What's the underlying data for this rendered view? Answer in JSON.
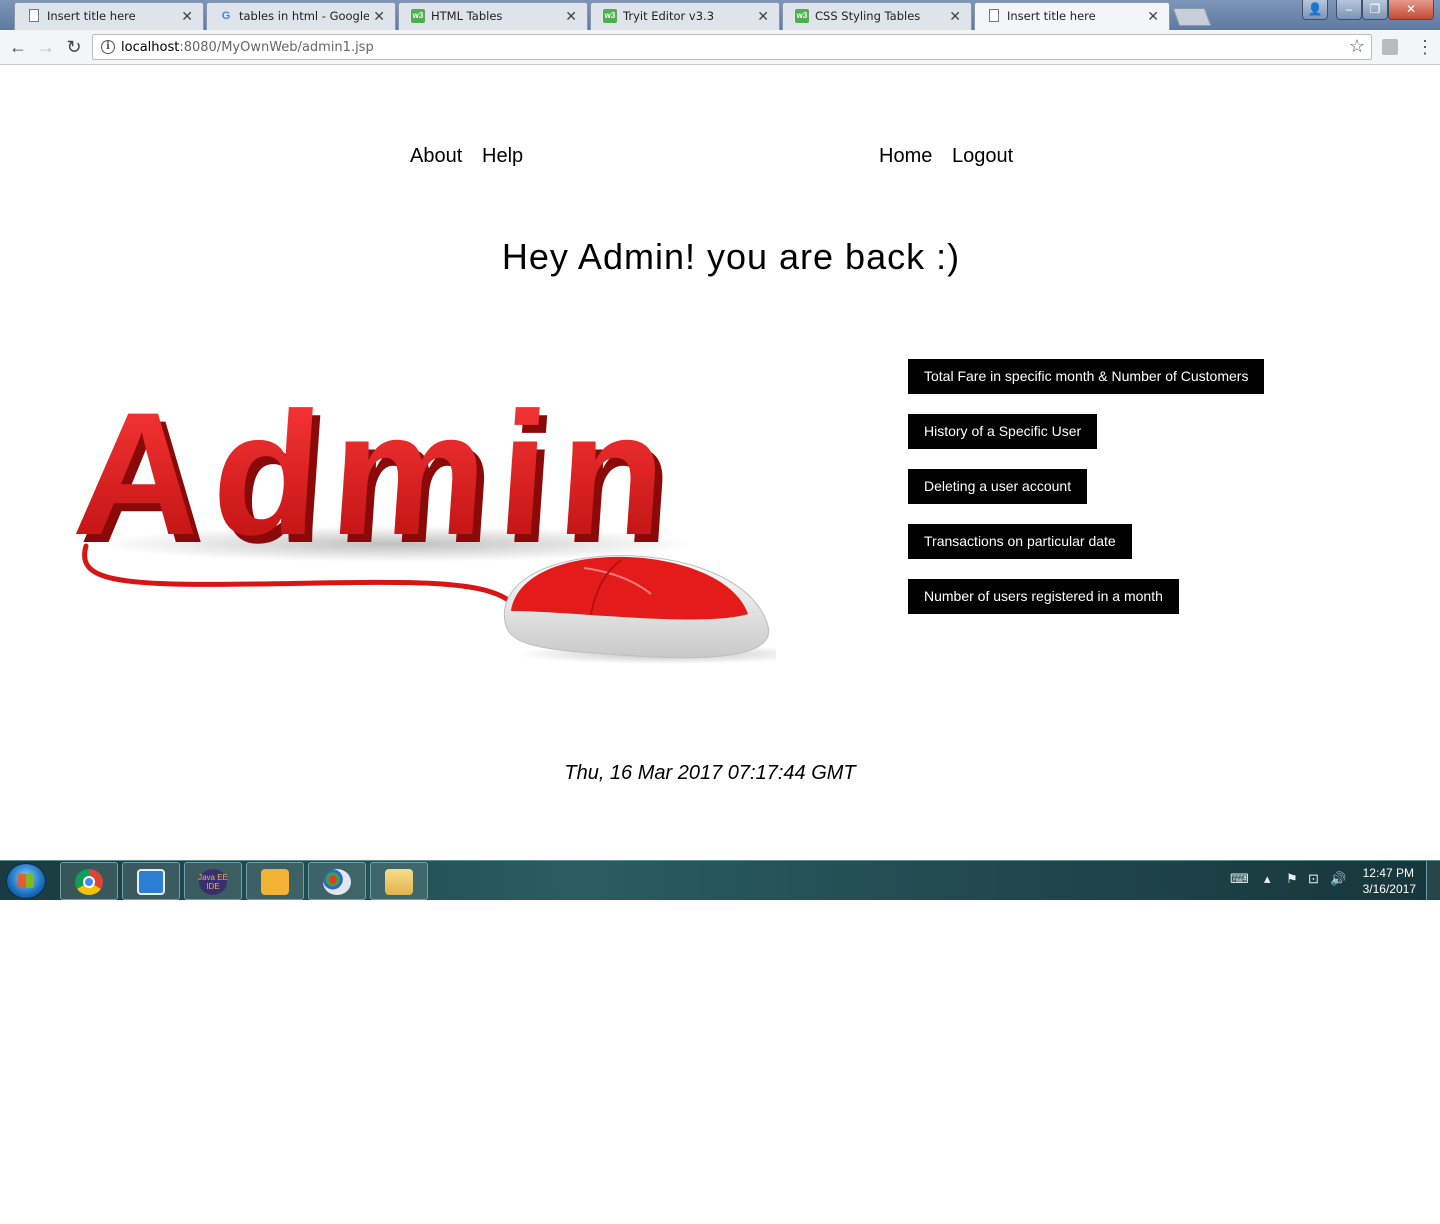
{
  "browser": {
    "tabs": [
      {
        "title": "Insert title here",
        "favicon": "page-icon",
        "active": false
      },
      {
        "title": "tables in html - Google S",
        "favicon": "google-icon",
        "active": false
      },
      {
        "title": "HTML Tables",
        "favicon": "w3schools-icon",
        "active": false
      },
      {
        "title": "Tryit Editor v3.3",
        "favicon": "w3schools-icon",
        "active": false
      },
      {
        "title": "CSS Styling Tables",
        "favicon": "w3schools-icon",
        "active": false
      },
      {
        "title": "Insert title here",
        "favicon": "page-icon",
        "active": true
      }
    ],
    "url_host": "localhost",
    "url_path": ":8080/MyOwnWeb/admin1.jsp"
  },
  "nav": {
    "about": "About",
    "help": "Help",
    "home": "Home",
    "logout": "Logout"
  },
  "greeting": "Hey Admin! you are back :)",
  "logo_text": "Admin",
  "admin_actions": [
    "Total Fare in specific month & Number of Customers",
    "History of a Specific User",
    "Deleting a user account",
    "Transactions on particular date",
    "Number of users registered in a month"
  ],
  "server_time": "Thu, 16 Mar 2017 07:17:44 GMT",
  "taskbar": {
    "apps": [
      "chrome-icon",
      "lync-icon",
      "java-ee-ide-icon",
      "outlook-icon",
      "paint-icon",
      "file-explorer-icon"
    ],
    "java_ide_label": "Java EE IDE",
    "clock_time": "12:47 PM",
    "clock_date": "3/16/2017"
  },
  "colors": {
    "logo_red": "#e31b1b",
    "button_bg": "#000000",
    "button_text": "#ffffff"
  }
}
